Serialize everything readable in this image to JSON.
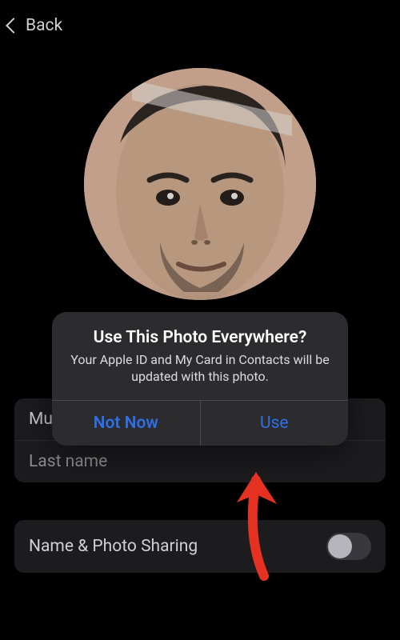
{
  "nav": {
    "back_label": "Back"
  },
  "form": {
    "first_name_value": "Muc",
    "last_name_placeholder": "Last name"
  },
  "sharing": {
    "label": "Name & Photo Sharing"
  },
  "alert": {
    "title": "Use This Photo Everywhere?",
    "message": "Your Apple ID and My Card in Contacts will be updated with this photo.",
    "cancel": "Not Now",
    "confirm": "Use"
  },
  "colors": {
    "accent": "#2f6fe5",
    "annotation": "#e53122"
  }
}
